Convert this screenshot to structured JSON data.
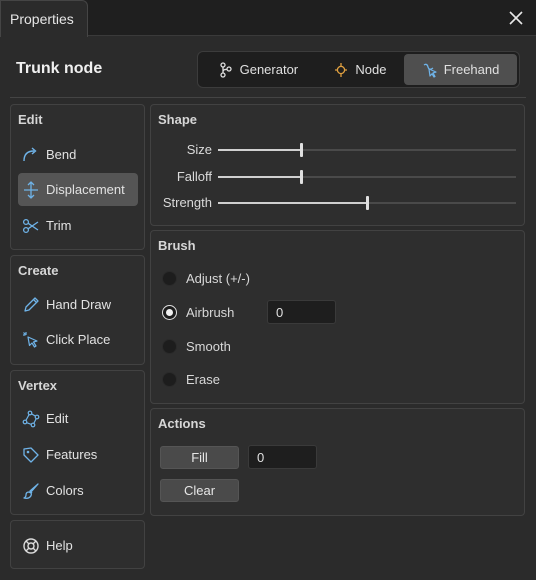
{
  "window": {
    "tab_title": "Properties"
  },
  "header": {
    "title": "Trunk node"
  },
  "modes": [
    {
      "label": "Generator",
      "icon": "generator-icon"
    },
    {
      "label": "Node",
      "icon": "node-icon"
    },
    {
      "label": "Freehand",
      "icon": "freehand-icon",
      "active": true
    }
  ],
  "edit": {
    "title": "Edit",
    "items": [
      {
        "label": "Bend",
        "icon": "bend-icon"
      },
      {
        "label": "Displacement",
        "icon": "displacement-icon",
        "active": true
      },
      {
        "label": "Trim",
        "icon": "scissors-icon"
      }
    ]
  },
  "create": {
    "title": "Create",
    "items": [
      {
        "label": "Hand Draw",
        "icon": "pencil-icon"
      },
      {
        "label": "Click Place",
        "icon": "click-cursor-icon"
      }
    ]
  },
  "vertex": {
    "title": "Vertex",
    "items": [
      {
        "label": "Edit",
        "icon": "vertex-edit-icon"
      },
      {
        "label": "Features",
        "icon": "tag-icon"
      },
      {
        "label": "Colors",
        "icon": "brush-icon"
      }
    ]
  },
  "help": {
    "label": "Help",
    "icon": "lifebuoy-icon"
  },
  "shape": {
    "title": "Shape",
    "sliders": [
      {
        "label": "Size",
        "value": 0.28
      },
      {
        "label": "Falloff",
        "value": 0.28
      },
      {
        "label": "Strength",
        "value": 0.5
      }
    ]
  },
  "brush": {
    "title": "Brush",
    "options": [
      {
        "label": "Adjust (+/-)",
        "selected": false
      },
      {
        "label": "Airbrush",
        "selected": true
      },
      {
        "label": "Smooth",
        "selected": false
      },
      {
        "label": "Erase",
        "selected": false
      }
    ],
    "airbrush_value": "0"
  },
  "actions": {
    "title": "Actions",
    "fill_label": "Fill",
    "fill_value": "0",
    "clear_label": "Clear"
  },
  "colors": {
    "accent": "#6fb3e8",
    "active_bg": "#555555",
    "node_icon": "#e0a040"
  }
}
